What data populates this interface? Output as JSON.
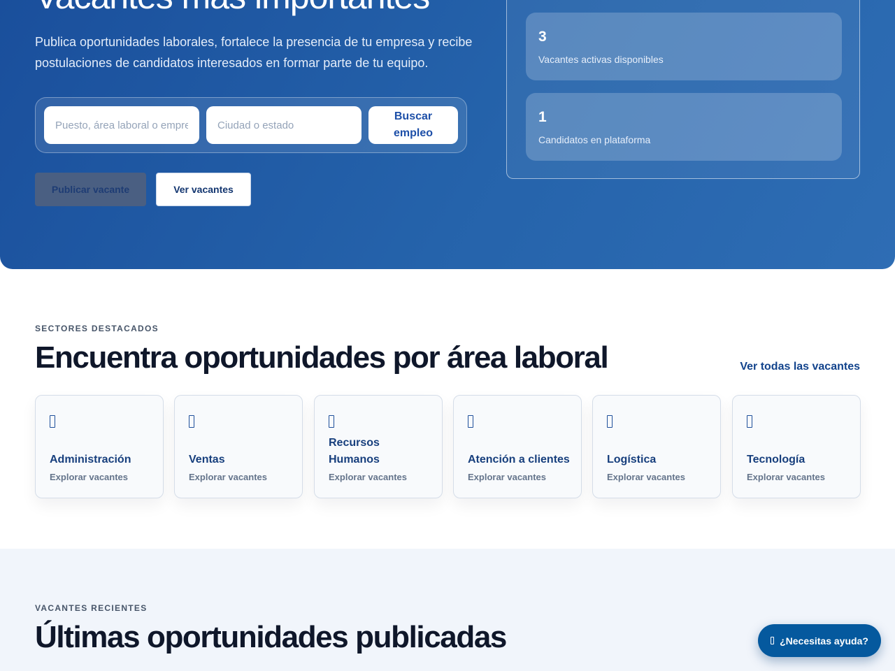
{
  "hero": {
    "title": "Vacantes más importantes",
    "subtitle": "Publica oportunidades laborales, fortalece la presencia de tu empresa y recibe postulaciones de candidatos interesados en formar parte de tu equipo.",
    "search": {
      "keyword_placeholder": "Puesto, área laboral o empresa",
      "location_placeholder": "Ciudad o estado",
      "button_label": "Buscar empleo"
    },
    "publish_label": "Publicar vacante",
    "view_label": "Ver vacantes",
    "stats": [
      {
        "value": "3",
        "label": "Vacantes activas disponibles"
      },
      {
        "value": "1",
        "label": "Candidatos en plataforma"
      }
    ]
  },
  "sectors": {
    "eyebrow": "SECTORES DESTACADOS",
    "title": "Encuentra oportunidades por área laboral",
    "see_all": "Ver todas las vacantes",
    "items": [
      {
        "name": "Administración",
        "link": "Explorar vacantes",
        "icon": "sector-icon"
      },
      {
        "name": "Ventas",
        "link": "Explorar vacantes",
        "icon": "sector-icon"
      },
      {
        "name": "Recursos Humanos",
        "link": "Explorar vacantes",
        "icon": "sector-icon"
      },
      {
        "name": "Atención a clientes",
        "link": "Explorar vacantes",
        "icon": "sector-icon"
      },
      {
        "name": "Logística",
        "link": "Explorar vacantes",
        "icon": "sector-icon"
      },
      {
        "name": "Tecnología",
        "link": "Explorar vacantes",
        "icon": "sector-icon"
      }
    ]
  },
  "recent": {
    "eyebrow": "VACANTES RECIENTES",
    "title": "Últimas oportunidades publicadas"
  },
  "help": {
    "label": "¿Necesitas ayuda?",
    "icon": "help-icon"
  },
  "colors": {
    "hero_gradient_start": "#1a4f9c",
    "hero_gradient_end": "#2e6db4",
    "brand_text": "#173f7d",
    "help_button": "#05599e"
  }
}
